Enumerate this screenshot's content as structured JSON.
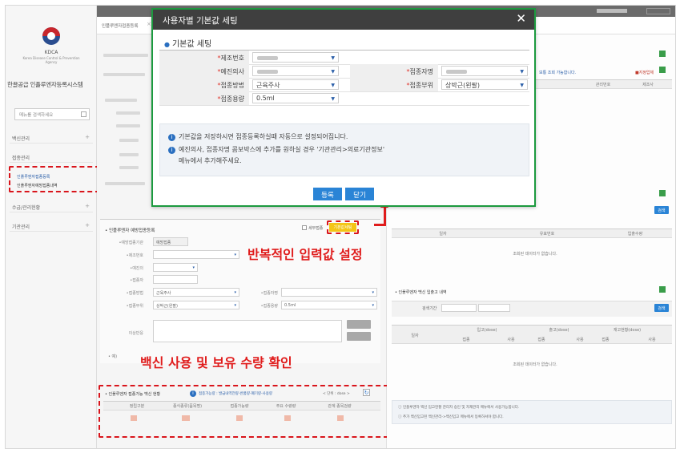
{
  "sidebar": {
    "org": "KDCA",
    "org_sub": "Korea Disease Control & Prevention Agency",
    "system_title": "한끌공급 인플루엔자등록시스템",
    "search_placeholder": "메뉴를 검색하세요",
    "menu": [
      {
        "label": "백신관리"
      },
      {
        "label": "접종관리"
      },
      {
        "label": "수급/관리현황"
      },
      {
        "label": "기관관리"
      }
    ],
    "submenu": [
      {
        "label": "인플루엔자접종등록"
      },
      {
        "label": "인플루엔자예방접종내역"
      }
    ]
  },
  "tabs": [
    "인플루엔자접종등록"
  ],
  "modal": {
    "title": "사용자별 기본값 세팅",
    "close": "✕",
    "subtitle": "기본값 세팅",
    "fields": {
      "lot": {
        "label": "제조번호",
        "value": ""
      },
      "doctor": {
        "label": "예진의사",
        "value": ""
      },
      "vaccinator": {
        "label": "접종자명",
        "value": ""
      },
      "method": {
        "label": "접종방법",
        "value": "근육주사"
      },
      "site": {
        "label": "접종부위",
        "value": "상박근(왼팔)"
      },
      "dose": {
        "label": "접종용량",
        "value": "0.5ml"
      }
    },
    "info": [
      "기본값을 저장하시면 접종등록하실때 자동으로 설정되어집니다.",
      "예진의사, 접종자명 콤보박스에 추가를 원하실 경우 '기관관리>의료기관정보'",
      "메뉴에서 추가해주세요."
    ],
    "buttons": {
      "register": "등록",
      "close": "닫기"
    }
  },
  "left_panel": {
    "sections": {
      "register_title": "인플루엔자 예방접종등록",
      "default_set": "기본값세팅",
      "check_label": "세부접종"
    },
    "form": {
      "method_value": "근육주사",
      "site_value": "상박근(왼팔)",
      "dose_value": "0.5ml",
      "clinic_value": "예방접종"
    },
    "vaccine_table": {
      "title": "인플루엔자 접종가능 백신 현황",
      "hint": "접종가능량 : 발급내역전량-반품량-폐기량-사용량",
      "unit": "< 단위 : dose >",
      "columns": [
        "정립구분",
        "종식종류(품목명)",
        "접종가능량",
        "주요 수량량",
        "관계 종목검량"
      ]
    }
  },
  "right_panel": {
    "notice": "보통 조회 가능합니다.",
    "legend": "■지정업체",
    "table1": {
      "columns": [
        "관리번호",
        "제조사"
      ]
    },
    "table2": {
      "columns": [
        "일자",
        "유효번호",
        "입출수량"
      ],
      "empty": "조회된 데이터가 없습니다."
    },
    "history_title": "인플루엔자 백신 입출고 내역",
    "search_label": "검색기간",
    "search_button": "검색",
    "table3": {
      "columns": [
        "일자",
        "입고(dose)",
        "출고(dose)",
        "재고현황(dose)"
      ],
      "sub": [
        "접종",
        "사용",
        "접종",
        "사용",
        "접종",
        "사용"
      ],
      "empty": "조회된 데이터가 없습니다."
    },
    "footer_notes": [
      "인플루엔자 백신 입고현황 관리자 승인 및 자재관리 메뉴에서 사용가능합니다.",
      "추가 백신입고된 백신관리->백신입고 메뉴에서 등록하셔야 합니다."
    ]
  },
  "annotations": {
    "repeat_input": "반복적인 입력값 설정",
    "vaccine_check": "백신 사용 및 보유 수량 확인"
  },
  "colors": {
    "modal_border": "#1c9a3f",
    "modal_header": "#3f3f3f",
    "button_blue": "#2a84d6",
    "annotation_red": "#e01c1c"
  }
}
